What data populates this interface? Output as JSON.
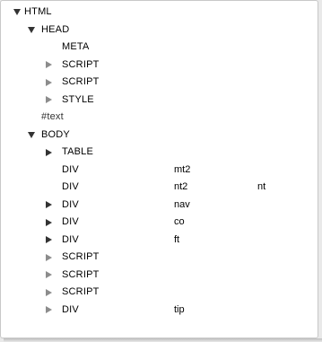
{
  "tree": {
    "html": "HTML",
    "head": "HEAD",
    "meta": "META",
    "script1": "SCRIPT",
    "script2": "SCRIPT",
    "style": "STYLE",
    "text": "#text",
    "body": "BODY",
    "table": "TABLE",
    "div_mt2": {
      "tag": "DIV",
      "id": "mt2"
    },
    "div_nt2": {
      "tag": "DIV",
      "id": "nt2",
      "class": "nt"
    },
    "div_nav": {
      "tag": "DIV",
      "id": "nav"
    },
    "div_co": {
      "tag": "DIV",
      "id": "co"
    },
    "div_ft": {
      "tag": "DIV",
      "id": "ft"
    },
    "script3": "SCRIPT",
    "script4": "SCRIPT",
    "script5": "SCRIPT",
    "div_tip": {
      "tag": "DIV",
      "id": "tip"
    }
  },
  "icons": {
    "expanded": "triangle-down-icon",
    "collapsed": "triangle-right-icon"
  },
  "colors": {
    "panel_bg": "#ffffff",
    "border": "#c8c8c8",
    "collapsed_triangle": "#8c8c8c",
    "expanded_triangle": "#333333"
  }
}
